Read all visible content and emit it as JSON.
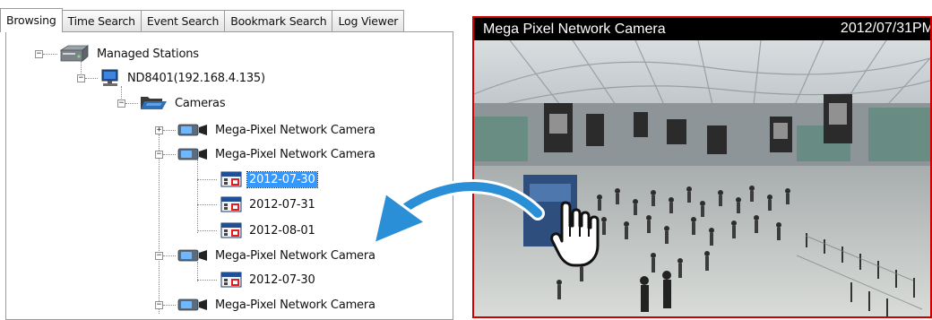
{
  "tabs": [
    {
      "label": "Browsing",
      "active": true
    },
    {
      "label": "Time Search",
      "active": false
    },
    {
      "label": "Event Search",
      "active": false
    },
    {
      "label": "Bookmark Search",
      "active": false
    },
    {
      "label": "Log Viewer",
      "active": false
    }
  ],
  "tree": {
    "root": {
      "label": "Managed Stations",
      "icon": "station-icon",
      "expanded": true
    },
    "station": {
      "label": "ND8401(192.168.4.135)",
      "icon": "computer-icon",
      "expanded": true
    },
    "cameras_folder": {
      "label": "Cameras",
      "icon": "folder-open-icon",
      "expanded": true
    },
    "cameras": [
      {
        "label": "Mega-Pixel Network Camera",
        "icon": "camera-icon",
        "expanded": false,
        "dates": []
      },
      {
        "label": "Mega-Pixel Network Camera",
        "icon": "camera-icon",
        "expanded": true,
        "dates": [
          {
            "label": "2012-07-30",
            "icon": "calendar-icon",
            "selected": true
          },
          {
            "label": "2012-07-31",
            "icon": "calendar-icon",
            "selected": false
          },
          {
            "label": "2012-08-01",
            "icon": "calendar-icon",
            "selected": false
          }
        ]
      },
      {
        "label": "Mega-Pixel Network Camera",
        "icon": "camera-icon",
        "expanded": true,
        "dates": [
          {
            "label": "2012-07-30",
            "icon": "calendar-icon",
            "selected": false
          }
        ]
      },
      {
        "label": "Mega-Pixel Network Camera",
        "icon": "camera-icon",
        "expanded": true,
        "dates": []
      }
    ]
  },
  "viewer": {
    "title": "Mega Pixel Network Camera",
    "timestamp": "2012/07/31PM",
    "border_color": "#d00000"
  },
  "overlay": {
    "arrow_icon": "curved-arrow-icon",
    "arrow_color": "#2a8fd6",
    "hand_icon": "drag-hand-icon"
  },
  "colors": {
    "selection": "#3399ff",
    "tab_border": "#9a9a9a"
  }
}
